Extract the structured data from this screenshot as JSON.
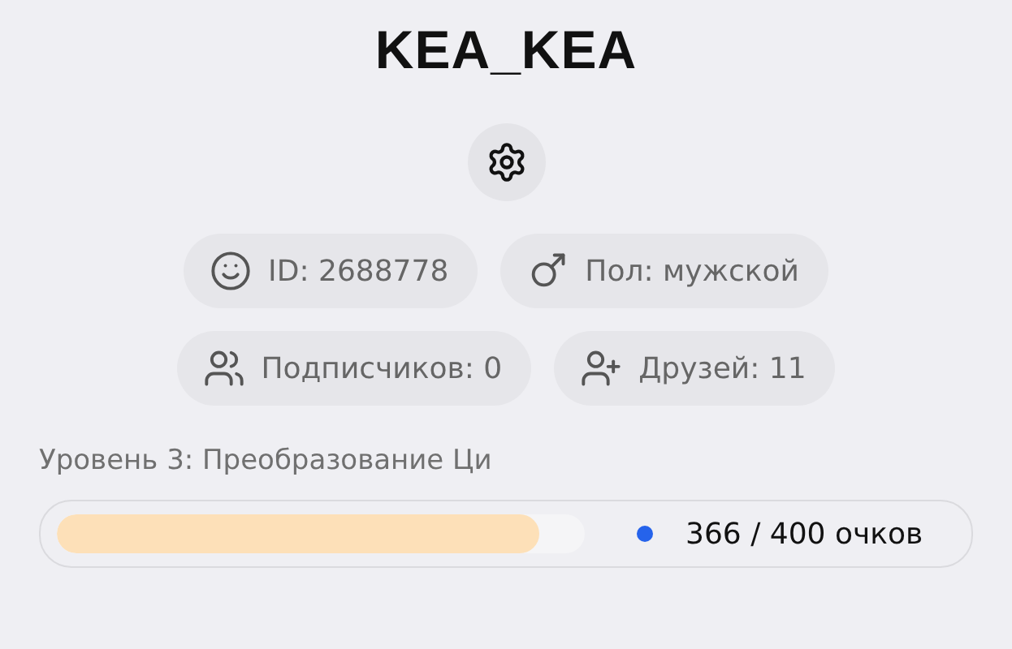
{
  "username": "KEA_KEA",
  "info_rows": [
    [
      {
        "kind": "id",
        "label": "ID: 2688778"
      },
      {
        "kind": "gender",
        "label": "Пол: мужской"
      }
    ],
    [
      {
        "kind": "followers",
        "label": "Подписчиков: 0"
      },
      {
        "kind": "friends",
        "label": "Друзей: 11"
      }
    ]
  ],
  "level": {
    "title": "Уровень 3: Преобразование Ци",
    "level": 0.915,
    "points": "366 / 400 очков"
  }
}
